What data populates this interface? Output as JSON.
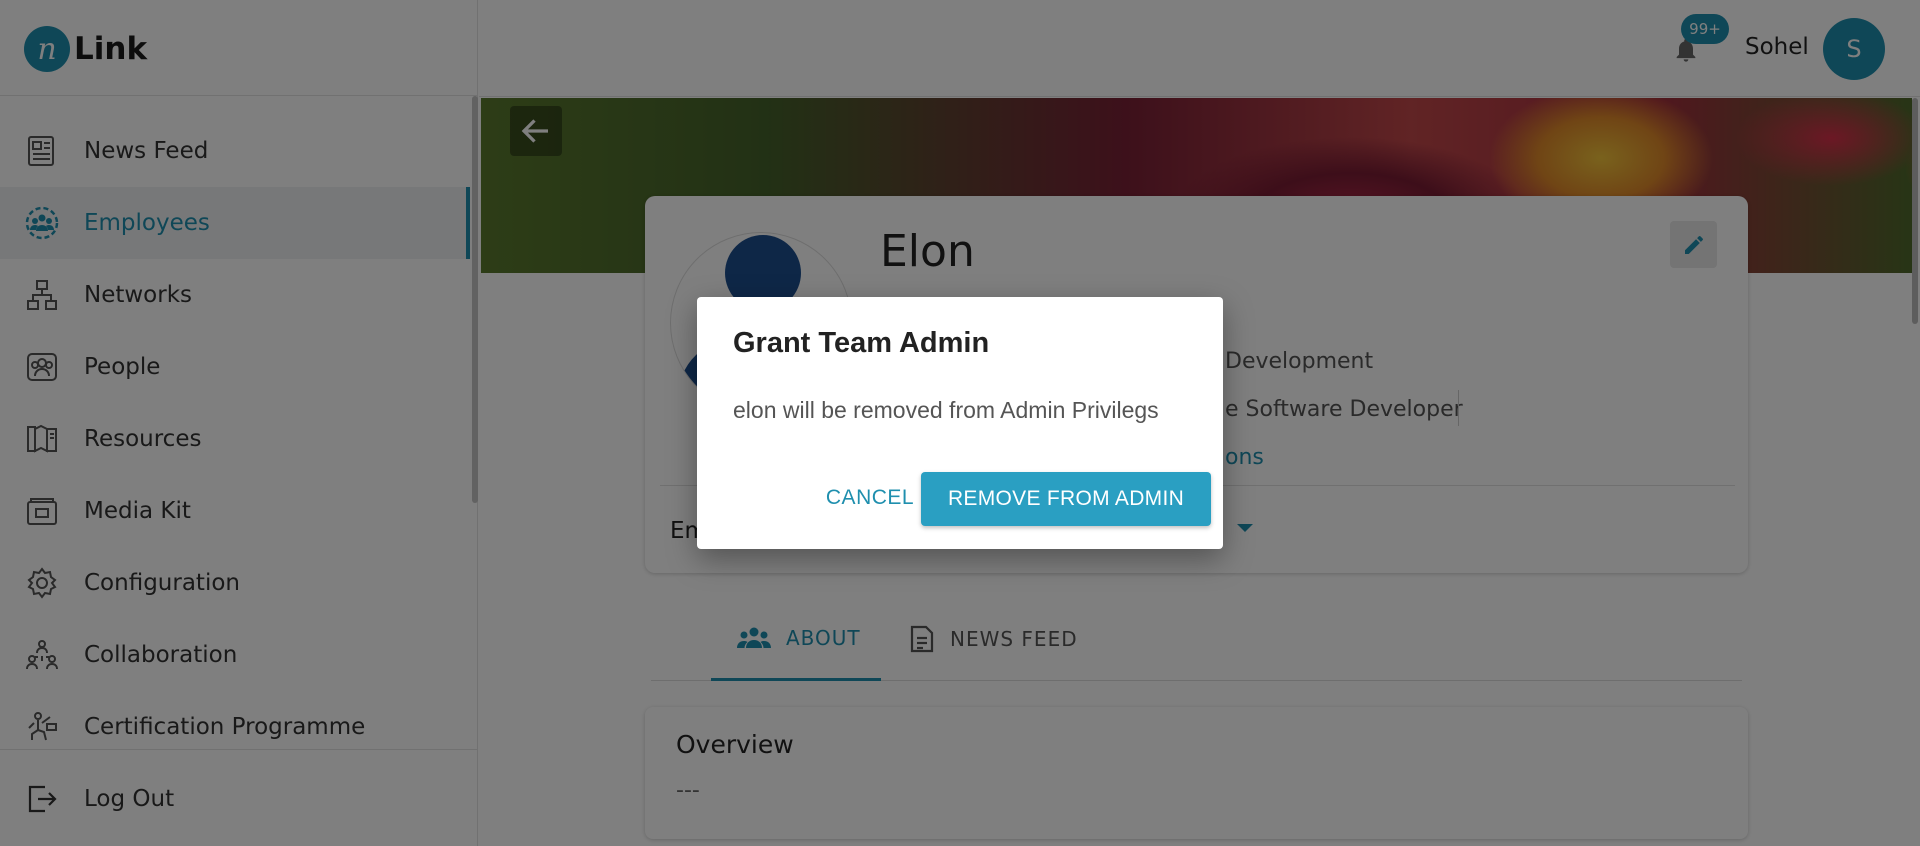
{
  "app": {
    "logo_text": "Link",
    "logo_mark": "n"
  },
  "sidebar": {
    "items": [
      {
        "label": "News Feed",
        "icon": "newspaper-icon"
      },
      {
        "label": "Employees",
        "icon": "employees-icon",
        "active": true
      },
      {
        "label": "Networks",
        "icon": "network-icon"
      },
      {
        "label": "People",
        "icon": "people-icon"
      },
      {
        "label": "Resources",
        "icon": "book-icon"
      },
      {
        "label": "Media Kit",
        "icon": "media-kit-icon"
      },
      {
        "label": "Configuration",
        "icon": "gear-icon"
      },
      {
        "label": "Collaboration",
        "icon": "collaboration-icon"
      },
      {
        "label": "Certification Programme",
        "icon": "certification-icon"
      }
    ],
    "logout_label": "Log Out"
  },
  "header": {
    "notification_count": "99+",
    "username": "Sohel",
    "avatar_initial": "S"
  },
  "profile": {
    "name": "Elon",
    "department_partial": "Development",
    "role_partial": "e Software Developer",
    "link_partial": "ons",
    "employment_label_partial": "Em"
  },
  "tabs": [
    {
      "label": "ABOUT",
      "icon": "group-icon",
      "active": true
    },
    {
      "label": "NEWS FEED",
      "icon": "document-icon"
    }
  ],
  "overview": {
    "title": "Overview",
    "value": "---"
  },
  "dialog": {
    "title": "Grant Team Admin",
    "message": "elon will be removed from Admin Privilegs",
    "cancel_label": "CANCEL",
    "confirm_label": "REMOVE FROM ADMIN"
  },
  "colors": {
    "accent": "#1f8fae",
    "button": "#2a9fc2",
    "overlay": "rgba(0,0,0,0.5)"
  }
}
